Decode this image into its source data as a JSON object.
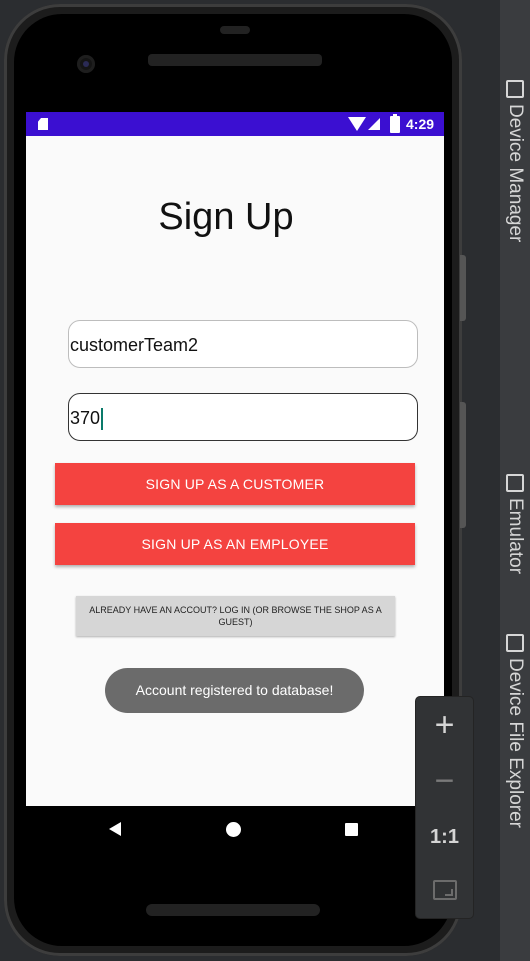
{
  "status_bar": {
    "time": "4:29"
  },
  "page": {
    "title": "Sign Up"
  },
  "form": {
    "username_value": "customerTeam2",
    "password_value": "370"
  },
  "buttons": {
    "customer": "SIGN UP AS A CUSTOMER",
    "employee": "SIGN UP AS AN EMPLOYEE",
    "login": "ALREADY HAVE AN ACCOUT? LOG IN (OR BROWSE THE SHOP AS A GUEST)"
  },
  "toast": {
    "message": "Account registered to database!"
  },
  "zoom_controls": {
    "zoom_in": "+",
    "zoom_out": "−",
    "actual_size": "1:1"
  },
  "side_tabs": [
    "Device Manager",
    "Emulator",
    "Device File Explorer"
  ],
  "colors": {
    "status_bar": "#3b0fd1",
    "primary_button": "#f44340",
    "toast": "#6b6b6b"
  },
  "icons": [
    "sd-card-icon",
    "wifi-icon",
    "signal-icon",
    "battery-icon",
    "back-icon",
    "home-icon",
    "recents-icon",
    "fit-screen-icon",
    "device-manager-icon",
    "emulator-icon",
    "device-file-explorer-icon"
  ]
}
